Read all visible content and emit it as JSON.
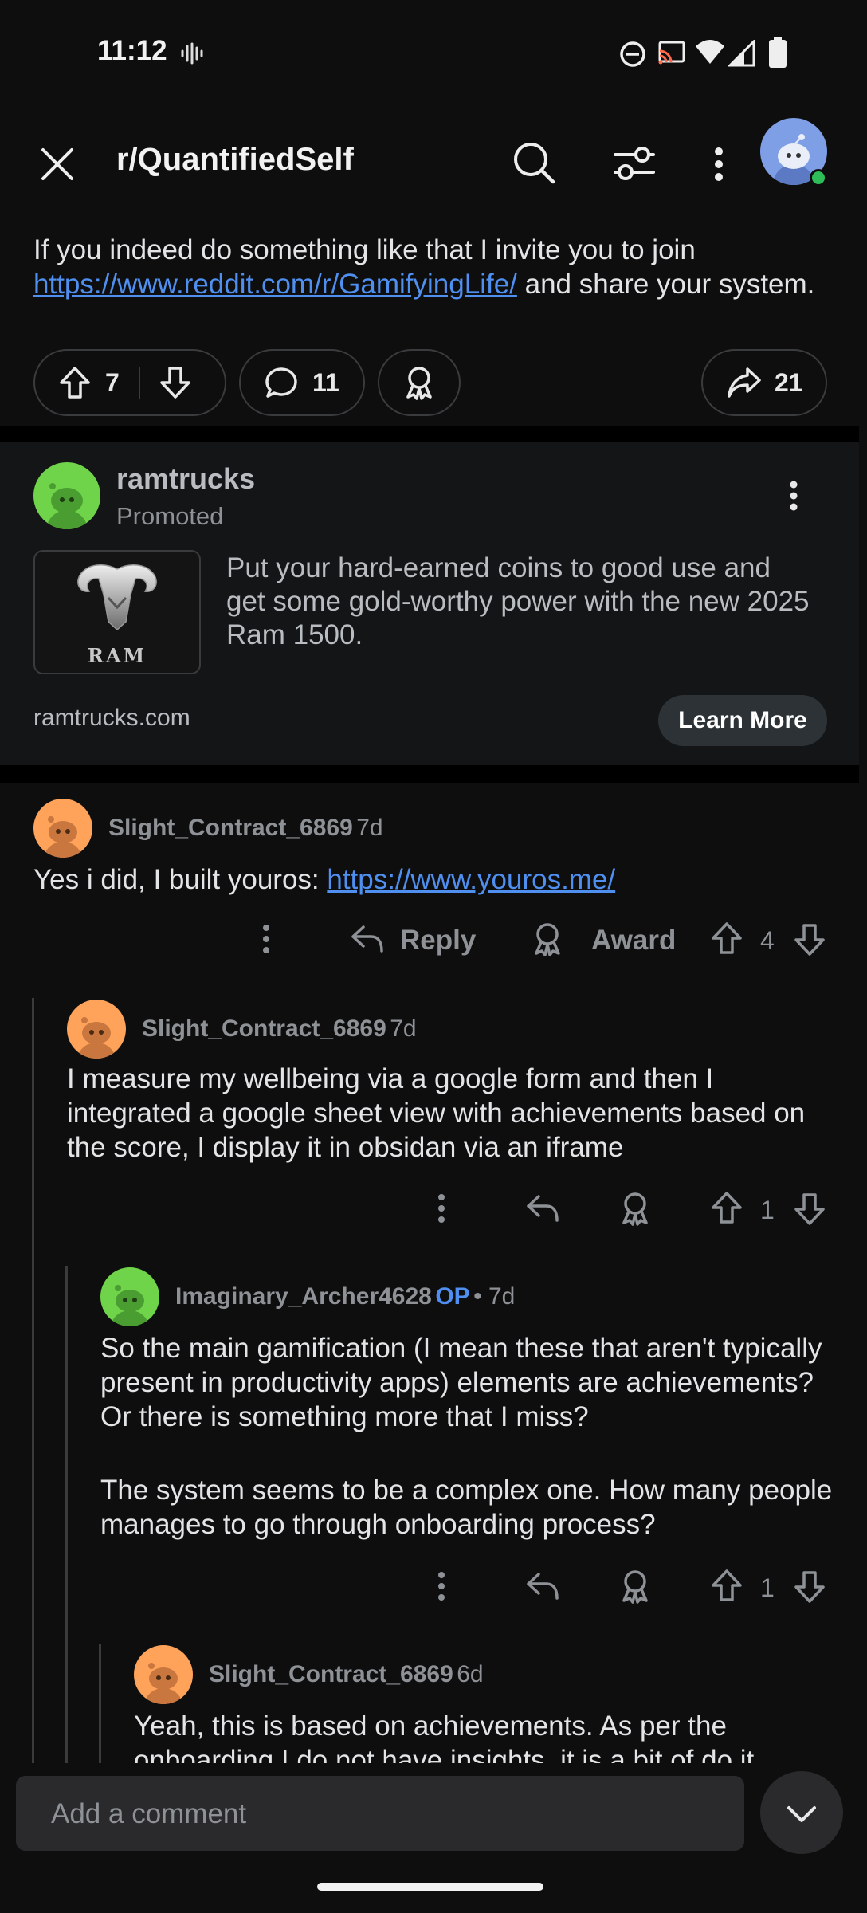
{
  "status_bar": {
    "time": "11:12"
  },
  "header": {
    "subreddit": "r/QuantifiedSelf"
  },
  "post": {
    "text_before": "If you indeed do something like that I invite you to join ",
    "link": "https://www.reddit.com/r/GamifyingLife/",
    "text_after": " and share your system.",
    "upvotes": "7",
    "comments": "11",
    "shares": "21"
  },
  "ad": {
    "advertiser": "ramtrucks",
    "promoted_label": "Promoted",
    "logo_text": "RAM",
    "body": "Put your hard-earned coins to good use and get some gold-worthy power with the new 2025 Ram 1500.",
    "domain": "ramtrucks.com",
    "cta": "Learn More"
  },
  "comments": [
    {
      "user": "Slight_Contract_6869",
      "age": "7d",
      "text_before": "Yes i did, I built youros: ",
      "link": "https://www.youros.me/",
      "reply_label": "Reply",
      "award_label": "Award",
      "votes": "4"
    },
    {
      "user": "Slight_Contract_6869",
      "age": "7d",
      "body": "I measure my wellbeing via a google form and then I integrated a google sheet view with achievements based on the score, I display it in obsidan via an iframe",
      "votes": "1"
    },
    {
      "user": "Imaginary_Archer4628",
      "op_label": "OP",
      "age": "• 7d",
      "body_p1": "So the main gamification (I mean these that aren't typically present in productivity apps) elements are achievements? Or there is something more that I miss?",
      "body_p2": "The system seems to be a complex one. How many people manages to go through onboarding process?",
      "votes": "1"
    },
    {
      "user": "Slight_Contract_6869",
      "age": "6d",
      "body": "Yeah, this is based on achievements. As per the onboarding I do not have insights, it is a bit of do it"
    }
  ],
  "composer": {
    "placeholder": "Add a comment"
  },
  "colors": {
    "link": "#4f8ff0",
    "background": "#0e0e0f",
    "online": "#2ebd59"
  }
}
